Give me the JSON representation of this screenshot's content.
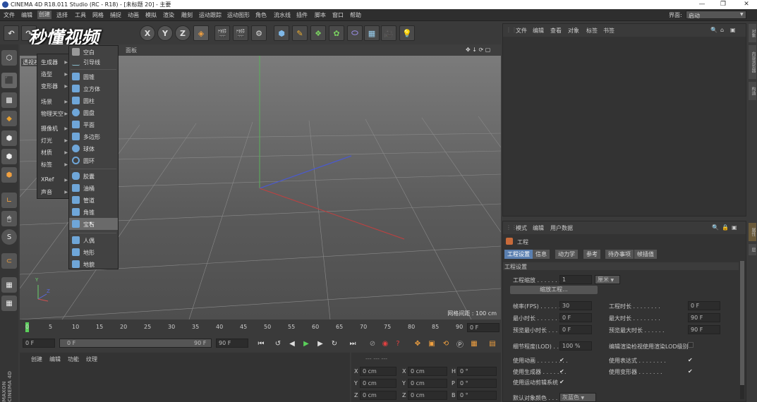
{
  "window": {
    "title": "CINEMA 4D R18.011 Studio (RC - R18) - [未标题 20] - 主要",
    "min": "—",
    "max": "❐",
    "close": "✕"
  },
  "menubar": {
    "items": [
      "文件",
      "编辑",
      "创建",
      "选择",
      "工具",
      "网格",
      "捕捉",
      "动画",
      "模拟",
      "渲染",
      "雕刻",
      "运动跟踪",
      "运动图形",
      "角色",
      "流水线",
      "插件",
      "脚本",
      "窗口",
      "帮助"
    ],
    "layout_label": "界面:",
    "layout_value": "启动"
  },
  "watermark": "秒懂视频",
  "toolbar": {
    "x": "X",
    "y": "Y",
    "z": "Z"
  },
  "viewport": {
    "menu": [
      "查看",
      "摄像机",
      "显示",
      "选项",
      "过滤",
      "面板"
    ],
    "label": "透视视图",
    "grid_spacing": "网格间距 : 100 cm",
    "axis_y": "Y",
    "axis_z": "Z",
    "nav_icons": "✥ ↓ ⟳ ▢"
  },
  "create_menu": {
    "items": [
      {
        "label": "生成器"
      },
      {
        "label": "造型"
      },
      {
        "label": "变形器"
      },
      {
        "label": "场景"
      },
      {
        "label": "物理天空"
      },
      {
        "label": "摄像机"
      },
      {
        "label": "灯光"
      },
      {
        "label": "材质"
      },
      {
        "label": "标签"
      },
      {
        "label": "XRef"
      },
      {
        "label": "声音"
      }
    ]
  },
  "object_submenu": {
    "items": [
      {
        "label": "空白"
      },
      {
        "label": "引导线"
      },
      {
        "label": "圆锥"
      },
      {
        "label": "立方体"
      },
      {
        "label": "圆柱"
      },
      {
        "label": "圆盘"
      },
      {
        "label": "平面"
      },
      {
        "label": "多边形"
      },
      {
        "label": "球体"
      },
      {
        "label": "圆环"
      },
      {
        "label": "胶囊"
      },
      {
        "label": "油桶"
      },
      {
        "label": "管道"
      },
      {
        "label": "角锥"
      },
      {
        "label": "宝石"
      },
      {
        "label": "人偶"
      },
      {
        "label": "地形"
      },
      {
        "label": "地貌"
      }
    ],
    "selected": "宝石"
  },
  "timeline": {
    "ticks": [
      "0",
      "5",
      "10",
      "15",
      "20",
      "25",
      "30",
      "35",
      "40",
      "45",
      "50",
      "55",
      "60",
      "65",
      "70",
      "75",
      "80",
      "85",
      "90"
    ],
    "current": "0 F"
  },
  "transport": {
    "start": "0 F",
    "slider_start": "0 F",
    "slider_end": "90 F",
    "end": "90 F"
  },
  "material_panel": {
    "menu": [
      "创建",
      "编辑",
      "功能",
      "纹理"
    ]
  },
  "coord_panel": {
    "rows": [
      {
        "a": "X",
        "av": "0 cm",
        "b": "X",
        "bv": "0 cm",
        "c": "H",
        "cv": "0 °"
      },
      {
        "a": "Y",
        "av": "0 cm",
        "b": "Y",
        "bv": "0 cm",
        "c": "P",
        "cv": "0 °"
      },
      {
        "a": "Z",
        "av": "0 cm",
        "b": "Z",
        "bv": "0 cm",
        "c": "B",
        "cv": "0 °"
      }
    ],
    "header": "---  ---  ---"
  },
  "object_manager": {
    "menu": [
      "文件",
      "编辑",
      "查看",
      "对象",
      "标签",
      "书签"
    ]
  },
  "attribute_manager": {
    "menu": [
      "模式",
      "编辑",
      "用户数据"
    ],
    "title": "工程",
    "tabs": [
      "工程设置",
      "信息",
      "动力学",
      "参考",
      "待办事项",
      "帧插值"
    ],
    "section": "工程设置",
    "scale_label": "工程缩放 . . . . . . . .",
    "scale_value": "1",
    "scale_unit": "厘米",
    "scale_button": "缩放工程...",
    "fps_label": "帧率(FPS) . . . . . . .",
    "fps_value": "30",
    "proj_len_label": "工程时长 . . . . . . . .",
    "proj_len_value": "0 F",
    "min_time_label": "最小时长 . . . . . . .",
    "min_time_value": "0 F",
    "max_time_label": "最大时长 . . . . . . . .",
    "max_time_value": "90 F",
    "prev_min_label": "预览最小时长 . . . .",
    "prev_min_value": "0 F",
    "prev_max_label": "预览最大时长 . . . . . .",
    "prev_max_value": "90 F",
    "lod_label": "细节程度(LOD) . . .",
    "lod_value": "100 %",
    "lod_render_label": "编辑渲染检视使用渲染LOD级别",
    "use_anim_label": "使用动画 . . . . . . . . .",
    "use_expr_label": "使用表达式 . . . . . . . .",
    "use_gen_label": "使用生成器 . . . . . . .",
    "use_deform_label": "使用变形器 . . . . . . .",
    "use_motion_label": "使用运动剪辑系统",
    "default_color_label": "默认对象颜色 . . .",
    "default_color_value": "灰蓝色",
    "check": "✔"
  },
  "right_strip": [
    "对象",
    "内容浏览器",
    "构造",
    "属性",
    "层"
  ],
  "maxon_logo": "MAXON CINEMA 4D"
}
